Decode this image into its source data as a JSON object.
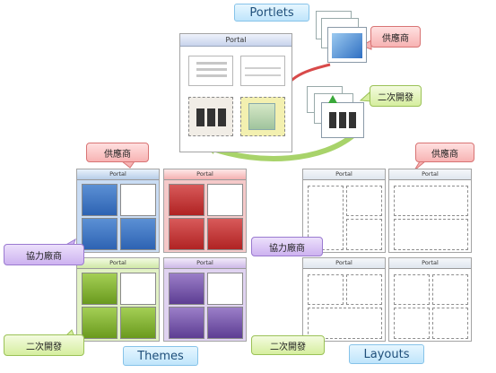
{
  "sections": {
    "portlets": "Portlets",
    "themes": "Themes",
    "layouts": "Layouts"
  },
  "portal_label": "Portal",
  "callouts": {
    "vendor": "供應商",
    "partner": "協力廠商",
    "secondary_dev": "二次開發"
  },
  "colors": {
    "vendor_callout": "#f7b3b3",
    "partner_callout": "#cdb2f0",
    "secondary_callout": "#d6ee9f",
    "arrow_red": "#d84a4a",
    "arrow_green": "#8ec255",
    "theme_blue": "#2e63b3",
    "theme_red": "#b02323",
    "theme_green": "#6a9a1e",
    "theme_purple": "#5d3d93"
  }
}
